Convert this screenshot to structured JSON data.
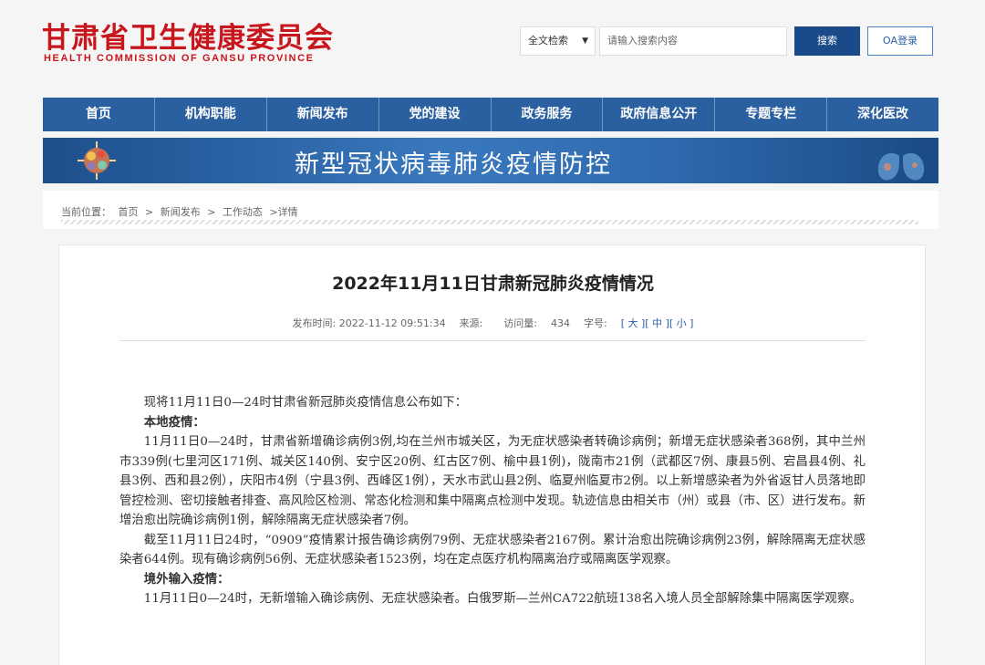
{
  "header": {
    "logo_cn": "甘肃省卫生健康委员会",
    "logo_en": "HEALTH COMMISSION OF GANSU PROVINCE",
    "search_scope": "全文检索",
    "search_placeholder": "请输入搜索内容",
    "search_button": "搜索",
    "oa_button": "OA登录"
  },
  "nav": {
    "items": [
      "首页",
      "机构职能",
      "新闻发布",
      "党的建设",
      "政务服务",
      "政府信息公开",
      "专题专栏",
      "深化医改"
    ]
  },
  "banner": {
    "title": "新型冠状病毒肺炎疫情防控"
  },
  "breadcrumb": {
    "label": "当前位置：",
    "items": [
      "首页",
      ">",
      "新闻发布",
      ">",
      "工作动态",
      ">详情"
    ]
  },
  "article": {
    "title": "2022年11月11日甘肃新冠肺炎疫情情况",
    "meta": {
      "publish_label": "发布时间:",
      "publish_time": "2022-11-12 09:51:34",
      "source_label": "来源:",
      "visits_label": "访问量:",
      "visits": "434",
      "fontsize_label": "字号:",
      "size_large": "大",
      "size_medium": "中",
      "size_small": "小"
    },
    "paragraphs": [
      "现将11月11日0—24时甘肃省新冠肺炎疫情信息公布如下：",
      "本地疫情：",
      "11月11日0—24时，甘肃省新增确诊病例3例,均在兰州市城关区，为无症状感染者转确诊病例；新增无症状感染者368例，其中兰州市339例(七里河区171例、城关区140例、安宁区20例、红古区7例、榆中县1例)，陇南市21例（武都区7例、康县5例、宕昌县4例、礼县3例、西和县2例），庆阳市4例（宁县3例、西峰区1例），天水市武山县2例、临夏州临夏市2例。以上新增感染者为外省返甘人员落地即管控检测、密切接触者排查、高风险区检测、常态化检测和集中隔离点检测中发现。轨迹信息由相关市（州）或县（市、区）进行发布。新增治愈出院确诊病例1例，解除隔离无症状感染者7例。",
      "截至11月11日24时，“0909”疫情累计报告确诊病例79例、无症状感染者2167例。累计治愈出院确诊病例23例，解除隔离无症状感染者644例。现有确诊病例56例、无症状感染者1523例，均在定点医疗机构隔离治疗或隔离医学观察。",
      "境外输入疫情：",
      "11月11日0—24时，无新增输入确诊病例、无症状感染者。白俄罗斯—兰州CA722航班138名入境人员全部解除集中隔离医学观察。"
    ]
  },
  "colors": {
    "brand_red": "#c8161d",
    "nav_blue": "#2a5fa0",
    "button_blue": "#1a4a8a"
  }
}
